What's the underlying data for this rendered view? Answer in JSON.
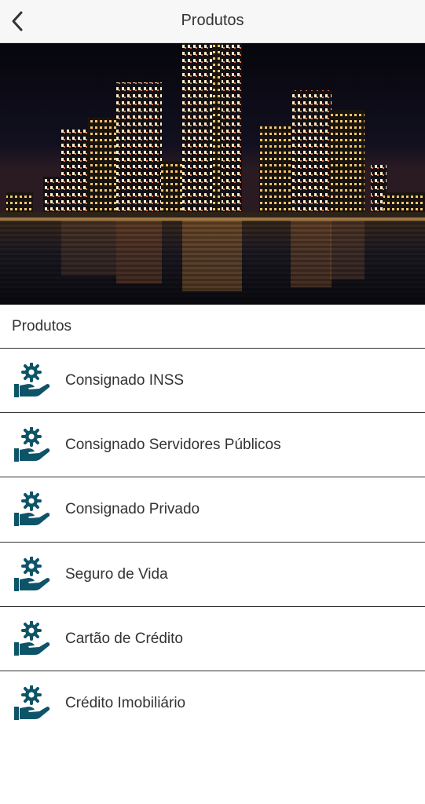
{
  "nav": {
    "title": "Produtos",
    "back_icon": "chevron-left-icon"
  },
  "hero": {
    "description_icon": "city-skyline-night-image"
  },
  "section": {
    "title": "Produtos"
  },
  "products": [
    {
      "label": "Consignado INSS",
      "icon": "hand-gear-icon"
    },
    {
      "label": "Consignado Servidores Públicos",
      "icon": "hand-gear-icon"
    },
    {
      "label": "Consignado Privado",
      "icon": "hand-gear-icon"
    },
    {
      "label": "Seguro de Vida",
      "icon": "hand-gear-icon"
    },
    {
      "label": "Cartão de Crédito",
      "icon": "hand-gear-icon"
    },
    {
      "label": "Crédito Imobiliário",
      "icon": "hand-gear-icon"
    }
  ],
  "colors": {
    "icon": "#0e5468",
    "text": "#333333",
    "nav_bg": "#f7f7f7"
  }
}
